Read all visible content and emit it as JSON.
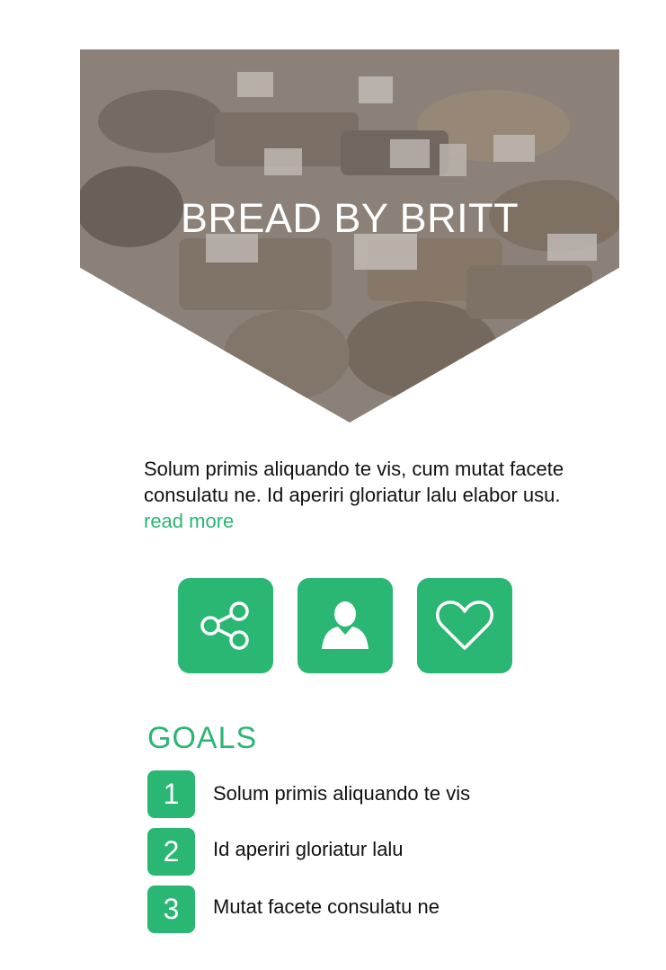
{
  "hero": {
    "title": "BREAD BY BRITT",
    "image": "bakery-display-photo"
  },
  "intro": {
    "text": "Solum primis aliquando te vis, cum mutat facete consulatu ne. Id aperiri gloriatur lalu elabor usu.",
    "link_label": "read more"
  },
  "actions": [
    {
      "icon": "share-icon"
    },
    {
      "icon": "user-icon"
    },
    {
      "icon": "heart-icon"
    }
  ],
  "goals": {
    "title": "GOALS",
    "items": [
      {
        "number": "1",
        "text": "Solum primis aliquando te vis"
      },
      {
        "number": "2",
        "text": "Id aperiri gloriatur lalu"
      },
      {
        "number": "3",
        "text": "Mutat facete consulatu ne"
      }
    ]
  },
  "colors": {
    "accent": "#2ab673",
    "hero_overlay": "#8a8178",
    "text": "#111111"
  }
}
